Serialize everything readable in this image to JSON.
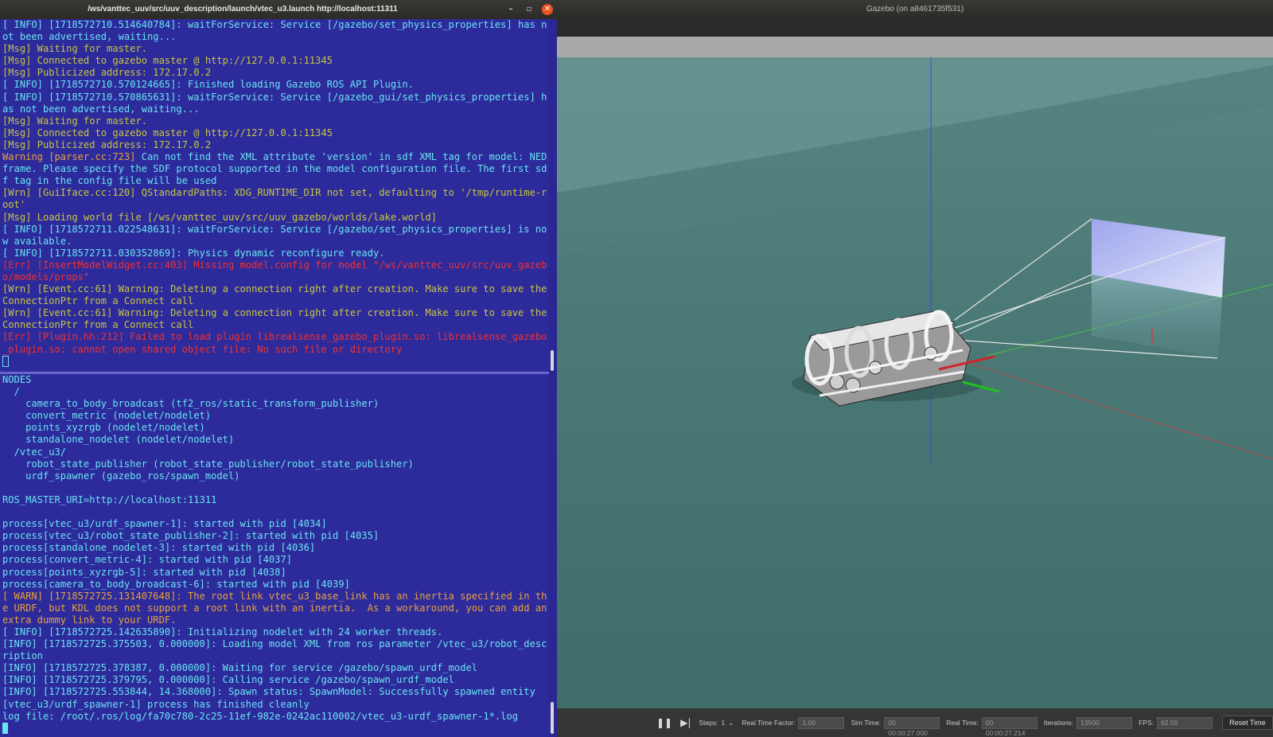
{
  "terminal": {
    "title": "/ws/vanttec_uuv/src/uuv_description/launch/vtec_u3.launch http://localhost:11311",
    "controls": {
      "minimize": "–",
      "maximize": "▫",
      "close": "✕"
    },
    "top_pane": [
      {
        "c": "cyan",
        "t": "[ INFO] [1718572710.514640784]: waitForService: Service [/gazebo/set_physics_properties] has not been advertised, waiting..."
      },
      {
        "c": "yellow",
        "t": "[Msg] Waiting for master."
      },
      {
        "c": "yellow",
        "t": "[Msg] Connected to gazebo master @ http://127.0.0.1:11345"
      },
      {
        "c": "yellow",
        "t": "[Msg] Publicized address: 172.17.0.2"
      },
      {
        "c": "cyan",
        "t": "[ INFO] [1718572710.570124665]: Finished loading Gazebo ROS API Plugin."
      },
      {
        "c": "cyan",
        "t": "[ INFO] [1718572710.570865631]: waitForService: Service [/gazebo_gui/set_physics_properties] has not been advertised, waiting..."
      },
      {
        "c": "yellow",
        "t": "[Msg] Waiting for master."
      },
      {
        "c": "yellow",
        "t": "[Msg] Connected to gazebo master @ http://127.0.0.1:11345"
      },
      {
        "c": "yellow",
        "t": "[Msg] Publicized address: 172.17.0.2"
      },
      {
        "c": "mixed",
        "a": "Warning [parser.cc:723] ",
        "b": "Can not find the XML attribute 'version' in sdf XML tag for model: NED frame. Please specify the SDF protocol supported in the model configuration file. The first sdf tag in the config file will be used"
      },
      {
        "c": "yellow",
        "t": "[Wrn] [GuiIface.cc:120] QStandardPaths: XDG_RUNTIME_DIR not set, defaulting to '/tmp/runtime-root'"
      },
      {
        "c": "yellow",
        "t": "[Msg] Loading world file [/ws/vanttec_uuv/src/uuv_gazebo/worlds/lake.world]"
      },
      {
        "c": "cyan",
        "t": "[ INFO] [1718572711.022548631]: waitForService: Service [/gazebo/set_physics_properties] is now available."
      },
      {
        "c": "cyan",
        "t": "[ INFO] [1718572711.030352869]: Physics dynamic reconfigure ready."
      },
      {
        "c": "red",
        "t": "[Err] [InsertModelWidget.cc:403] Missing model.config for model \"/ws/vanttec_uuv/src/uuv_gazebo/models/props\""
      },
      {
        "c": "yellow",
        "t": "[Wrn] [Event.cc:61] Warning: Deleting a connection right after creation. Make sure to save the ConnectionPtr from a Connect call"
      },
      {
        "c": "yellow",
        "t": "[Wrn] [Event.cc:61] Warning: Deleting a connection right after creation. Make sure to save the ConnectionPtr from a Connect call"
      },
      {
        "c": "red",
        "t": "[Err] [Plugin.hh:212] Failed to load plugin librealsense_gazebo_plugin.so: librealsense_gazebo_plugin.so: cannot open shared object file: No such file or directory"
      }
    ],
    "bottom_pane": [
      {
        "c": "cyan",
        "t": "NODES"
      },
      {
        "c": "cyan",
        "t": "  /"
      },
      {
        "c": "cyan",
        "t": "    camera_to_body_broadcast (tf2_ros/static_transform_publisher)"
      },
      {
        "c": "cyan",
        "t": "    convert_metric (nodelet/nodelet)"
      },
      {
        "c": "cyan",
        "t": "    points_xyzrgb (nodelet/nodelet)"
      },
      {
        "c": "cyan",
        "t": "    standalone_nodelet (nodelet/nodelet)"
      },
      {
        "c": "cyan",
        "t": "  /vtec_u3/"
      },
      {
        "c": "cyan",
        "t": "    robot_state_publisher (robot_state_publisher/robot_state_publisher)"
      },
      {
        "c": "cyan",
        "t": "    urdf_spawner (gazebo_ros/spawn_model)"
      },
      {
        "c": "cyan",
        "t": ""
      },
      {
        "c": "cyan",
        "t": "ROS_MASTER_URI=http://localhost:11311"
      },
      {
        "c": "cyan",
        "t": ""
      },
      {
        "c": "cyan",
        "t": "process[vtec_u3/urdf_spawner-1]: started with pid [4034]"
      },
      {
        "c": "cyan",
        "t": "process[vtec_u3/robot_state_publisher-2]: started with pid [4035]"
      },
      {
        "c": "cyan",
        "t": "process[standalone_nodelet-3]: started with pid [4036]"
      },
      {
        "c": "cyan",
        "t": "process[convert_metric-4]: started with pid [4037]"
      },
      {
        "c": "cyan",
        "t": "process[points_xyzrgb-5]: started with pid [4038]"
      },
      {
        "c": "cyan",
        "t": "process[camera_to_body_broadcast-6]: started with pid [4039]"
      },
      {
        "c": "orange",
        "t": "[ WARN] [1718572725.131407648]: The root link vtec_u3_base_link has an inertia specified in the URDF, but KDL does not support a root link with an inertia.  As a workaround, you can add an extra dummy link to your URDF."
      },
      {
        "c": "cyan",
        "t": "[ INFO] [1718572725.142635890]: Initializing nodelet with 24 worker threads."
      },
      {
        "c": "cyan",
        "t": "[INFO] [1718572725.375503, 0.000000]: Loading model XML from ros parameter /vtec_u3/robot_description"
      },
      {
        "c": "cyan",
        "t": "[INFO] [1718572725.378387, 0.000000]: Waiting for service /gazebo/spawn_urdf_model"
      },
      {
        "c": "cyan",
        "t": "[INFO] [1718572725.379795, 0.000000]: Calling service /gazebo/spawn_urdf_model"
      },
      {
        "c": "cyan",
        "t": "[INFO] [1718572725.553844, 14.368000]: Spawn status: SpawnModel: Successfully spawned entity"
      },
      {
        "c": "cyan",
        "t": "[vtec_u3/urdf_spawner-1] process has finished cleanly"
      },
      {
        "c": "cyan",
        "t": "log file: /root/.ros/log/fa70c780-2c25-11ef-982e-0242ac110002/vtec_u3-urdf_spawner-1*.log"
      }
    ],
    "colors": {
      "background": "#2d2a9c",
      "cyan": "#68e4ee",
      "yellow": "#c7c63e",
      "orange": "#e6a23c",
      "red": "#f0322f"
    }
  },
  "gazebo": {
    "title": "Gazebo (on a8461735f531)",
    "bottom_bar": {
      "pause_icon": "pause-icon",
      "step_icon": "step-icon",
      "steps_label": "Steps:",
      "steps_value": "1",
      "rtf_label": "Real Time Factor:",
      "rtf_value": "1.00",
      "sim_time_label": "Sim Time:",
      "sim_time_value": "00 00:00:27.000",
      "real_time_label": "Real Time:",
      "real_time_value": "00 00:00:27.214",
      "iterations_label": "Iterations:",
      "iterations_value": "13500",
      "fps_label": "FPS:",
      "fps_value": "62.50",
      "reset_label": "Reset Time"
    }
  }
}
